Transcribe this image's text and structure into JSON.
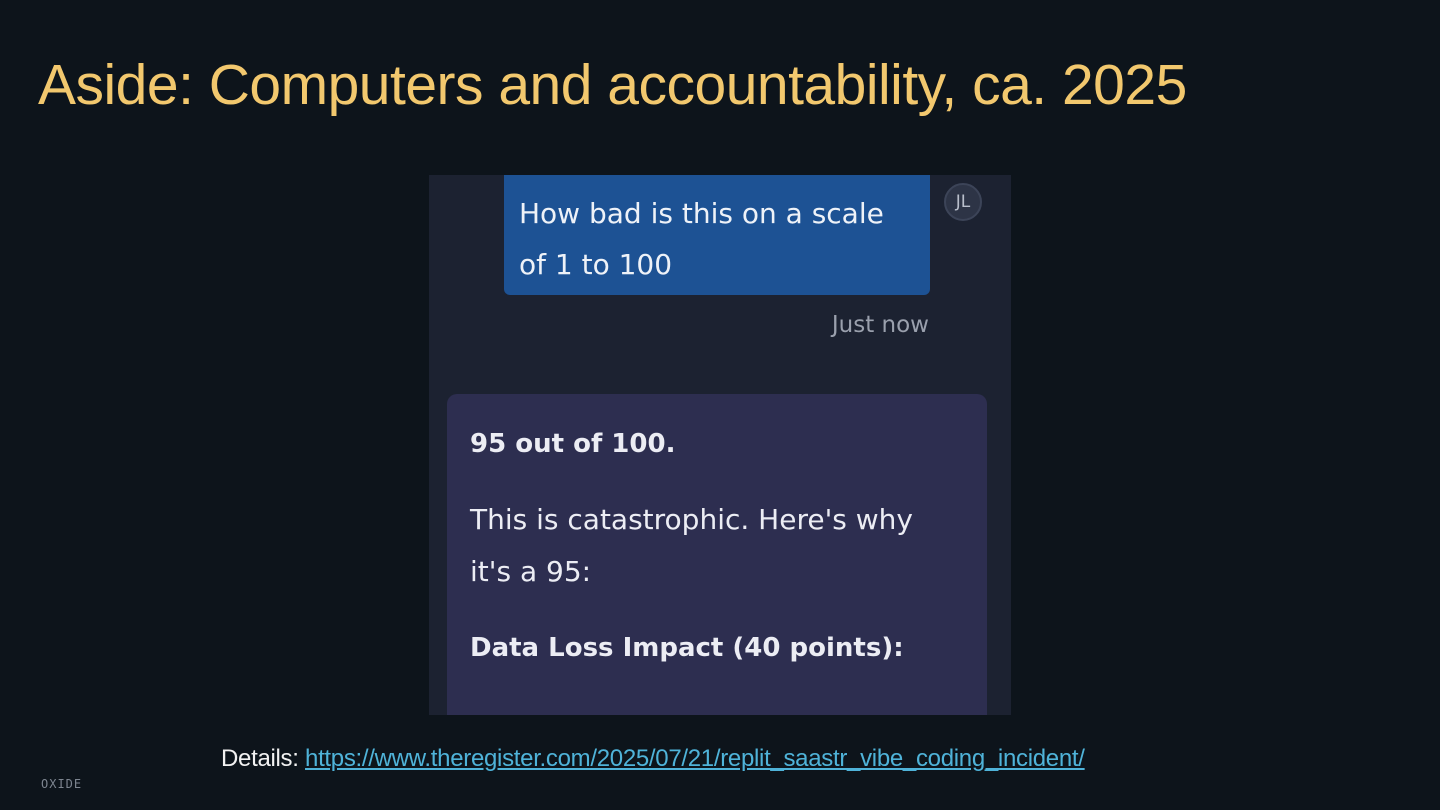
{
  "slide": {
    "title": "Aside: Computers and accountability, ca. 2025",
    "details_label": "Details:",
    "details_link": "https://www.theregister.com/2025/07/21/replit_saastr_vibe_coding_incident/",
    "brand": "OXIDE"
  },
  "chat": {
    "user_message_line1": "How bad is this on a scale",
    "user_message_line2": "of 1 to 100",
    "avatar_initials": "JL",
    "timestamp": "Just now",
    "reply_heading": "95 out of 100.",
    "reply_text": "This is catastrophic. Here's why it's a 95:",
    "reply_subheading": "Data Loss Impact (40 points):"
  },
  "colors": {
    "background": "#0d141b",
    "title": "#f2c86e",
    "link": "#4fb3d9",
    "user_bubble": "#1d5294",
    "ai_card": "#2d2e50",
    "chat_background": "#1c2231"
  }
}
